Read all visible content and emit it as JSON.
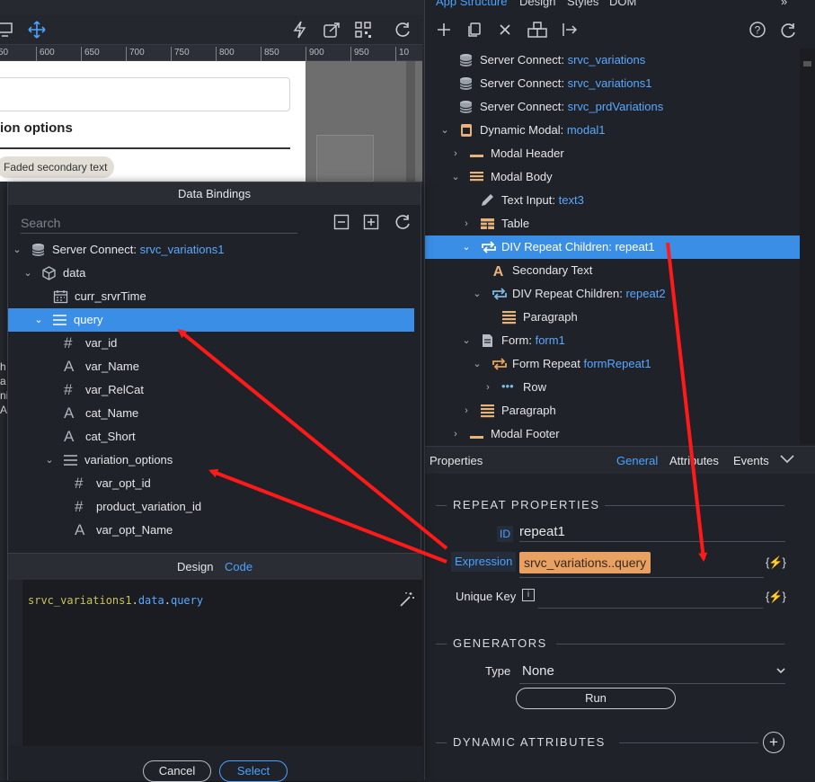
{
  "right_tabs": [
    "App Structure",
    "Design",
    "Styles",
    "DOM"
  ],
  "ruler_ticks": [
    "50",
    "600",
    "650",
    "700",
    "750",
    "800",
    "850",
    "900",
    "950",
    "10"
  ],
  "canvas": {
    "heading": "ion options",
    "badge": "Faded secondary text",
    "edge_text": [
      "h",
      "a",
      "ni",
      "A"
    ]
  },
  "structure_tree": [
    {
      "type": "Server Connect:",
      "value": "srvc_variations"
    },
    {
      "type": "Server Connect:",
      "value": "srvc_variations1"
    },
    {
      "type": "Server Connect:",
      "value": "srvc_prdVariations"
    },
    {
      "type": "Dynamic Modal:",
      "value": "modal1"
    },
    {
      "type": "Modal Header",
      "value": ""
    },
    {
      "type": "Modal Body",
      "value": ""
    },
    {
      "type": "Text Input:",
      "value": "text3"
    },
    {
      "type": "Table",
      "value": ""
    },
    {
      "type": "DIV Repeat Children:",
      "value": "repeat1"
    },
    {
      "type": "Secondary Text",
      "value": ""
    },
    {
      "type": "DIV Repeat Children:",
      "value": "repeat2"
    },
    {
      "type": "Paragraph",
      "value": ""
    },
    {
      "type": "Form:",
      "value": "form1"
    },
    {
      "type": "Form Repeat",
      "value": "formRepeat1"
    },
    {
      "type": "Row",
      "value": ""
    },
    {
      "type": "Paragraph",
      "value": ""
    },
    {
      "type": "Modal Footer",
      "value": ""
    }
  ],
  "properties": {
    "title": "Properties",
    "tabs": [
      "General",
      "Attributes",
      "Events"
    ],
    "repeat_section": "REPEAT PROPERTIES",
    "id_label": "ID",
    "id_value": "repeat1",
    "expression_label": "Expression",
    "expression_value": "srvc_variations..query",
    "unique_key_label": "Unique Key",
    "bolt_label": "{⚡}",
    "generators_section": "GENERATORS",
    "type_label": "Type",
    "type_value": "None",
    "run_label": "Run",
    "dynamic_section": "DYNAMIC ATTRIBUTES"
  },
  "dialog": {
    "title": "Data Bindings",
    "search_placeholder": "Search",
    "tree": [
      {
        "label": "Server Connect:",
        "value": "srvc_variations1"
      },
      {
        "label": "data",
        "value": ""
      },
      {
        "label": "curr_srvrTime",
        "value": ""
      },
      {
        "label": "query",
        "value": ""
      },
      {
        "label": "var_id",
        "value": ""
      },
      {
        "label": "var_Name",
        "value": ""
      },
      {
        "label": "var_RelCat",
        "value": ""
      },
      {
        "label": "cat_Name",
        "value": ""
      },
      {
        "label": "cat_Short",
        "value": ""
      },
      {
        "label": "variation_options",
        "value": ""
      },
      {
        "label": "var_opt_id",
        "value": ""
      },
      {
        "label": "product_variation_id",
        "value": ""
      },
      {
        "label": "var_opt_Name",
        "value": ""
      }
    ],
    "mode_design": "Design",
    "mode_code": "Code",
    "code": {
      "part1": "srvc_variations1",
      "dot1": ".",
      "part2": "data",
      "dot2": ".",
      "part3": "query"
    },
    "cancel_label": "Cancel",
    "select_label": "Select"
  },
  "colors": {
    "accent": "#3a8ee6",
    "link": "#5aa8ff",
    "arrow": "#ff1a1a",
    "pill": "#e8a063"
  }
}
